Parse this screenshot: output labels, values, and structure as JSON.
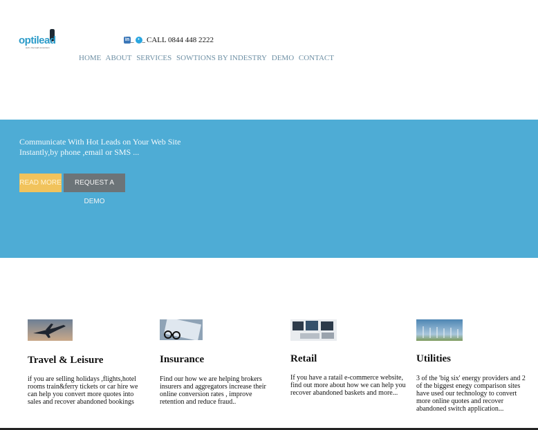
{
  "brand": {
    "logo_text": "optilead",
    "logo_tagline": "web • live lead conversion"
  },
  "header": {
    "call_text": "CALL 0844 448 2222",
    "social": [
      "linkedin-icon",
      "twitter-icon"
    ]
  },
  "nav": {
    "items": [
      "HOME",
      "ABOUT",
      "SERVICES",
      "SOWTIONS BY INDESTRY",
      "DEMO",
      "CONTACT"
    ]
  },
  "hero": {
    "line1": "Communicate With Hot Leads on Your Web Site",
    "line2": "Instantly,by phone ,email or SMS ...",
    "read_more": "READ MORE",
    "request_demo": "REQUEST A DEMO",
    "background": "#4eacd5"
  },
  "industries": [
    {
      "title": "Travel & Leisure",
      "text": "if you are selling holidays ,flights,hotel rooms train&ferry tickets or car hire we can help you convert more quotes into sales and recover abandoned bookings"
    },
    {
      "title": "Insurance",
      "text": "Find our how we are helping brokers insurers and aggregators increase their online conversion rates , improve retention and reduce fraud.."
    },
    {
      "title": "Retail",
      "text": "If you have a ratail e-commerce website, find out more about how we can help you recover abandoned baskets and more..."
    },
    {
      "title": "Utilities",
      "text": "3 of the 'big six' energy providers and 2 of the biggest enegy comparison sites have used our technology to convert more online quotes and recover abandoned switch application..."
    }
  ]
}
